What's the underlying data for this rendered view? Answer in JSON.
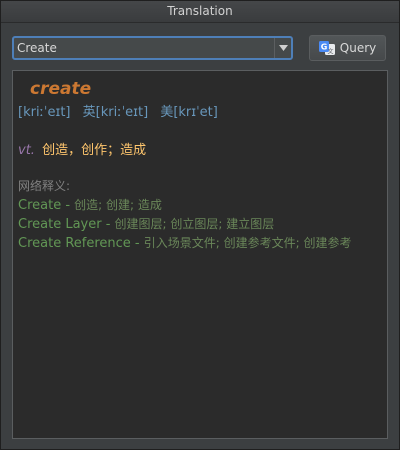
{
  "window": {
    "title": "Translation"
  },
  "toolbar": {
    "combo_value": "Create",
    "query_label": "Query",
    "icons": {
      "dropdown": "chevron-down-icon",
      "translate": "google-translate-icon"
    }
  },
  "result": {
    "word": "create",
    "phonetics": [
      "[kriːˈeɪt]",
      "英[kriːˈeɪt]",
      "美[krɪˈet]"
    ],
    "meaning": {
      "pos": "vt.",
      "text": "创造，创作；造成"
    },
    "web_heading": "网络释义:",
    "web_items": [
      {
        "term": "Create",
        "sep": " - ",
        "translations": "创造; 创建; 造成"
      },
      {
        "term": "Create Layer",
        "sep": " - ",
        "translations": "创建图层; 创立图层; 建立图层"
      },
      {
        "term": "Create Reference",
        "sep": " - ",
        "translations": "引入场景文件; 创建参考文件; 创建参考"
      }
    ]
  },
  "colors": {
    "word": "#cc7832",
    "phonetic": "#6897bb",
    "pos": "#9876aa",
    "meaning": "#ffc66d",
    "web_heading": "#808080",
    "web_term": "#629755",
    "combo_focus_border": "#4e7fb8"
  }
}
